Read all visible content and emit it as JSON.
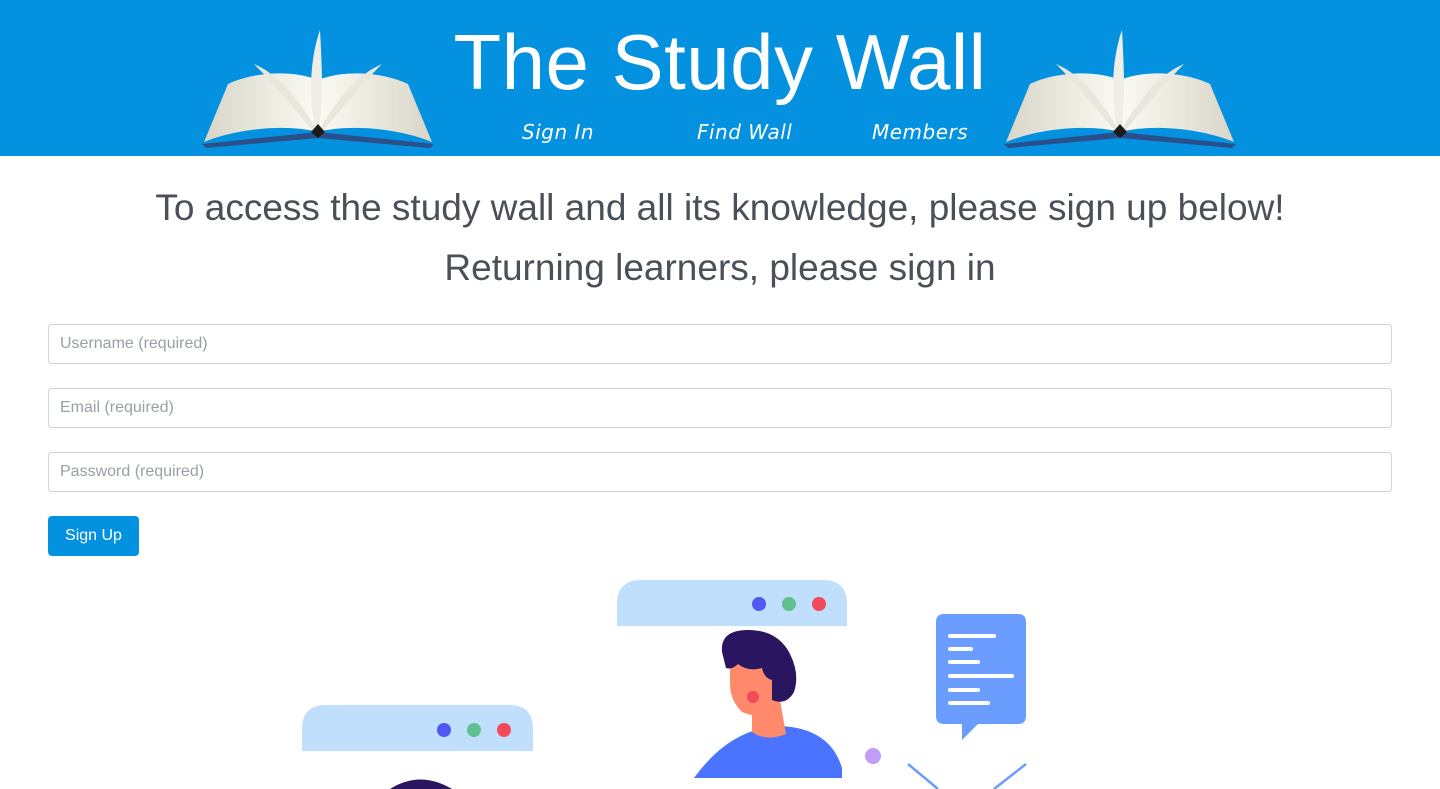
{
  "colors": {
    "brand": "#0391e0",
    "bubble": "#bfdffc",
    "dot_blue": "#5156f5",
    "dot_green": "#5ec18e",
    "dot_red": "#f24a5a",
    "hair": "#2a1560",
    "skin": "#ff8a6b",
    "shirt": "#4a74ff",
    "doc": "#6b9cff"
  },
  "header": {
    "title": "The Study Wall",
    "nav": [
      {
        "label": "Sign In"
      },
      {
        "label": "Find Wall"
      },
      {
        "label": "Members"
      }
    ]
  },
  "main": {
    "headline": "To access the study wall and all its knowledge, please sign up below!",
    "subheadline": "Returning learners, please sign in",
    "form": {
      "username_placeholder": "Username (required)",
      "email_placeholder": "Email (required)",
      "password_placeholder": "Password (required)",
      "submit_label": "Sign Up"
    }
  },
  "icons": {
    "header_left": "open-book-icon",
    "header_right": "open-book-icon"
  }
}
